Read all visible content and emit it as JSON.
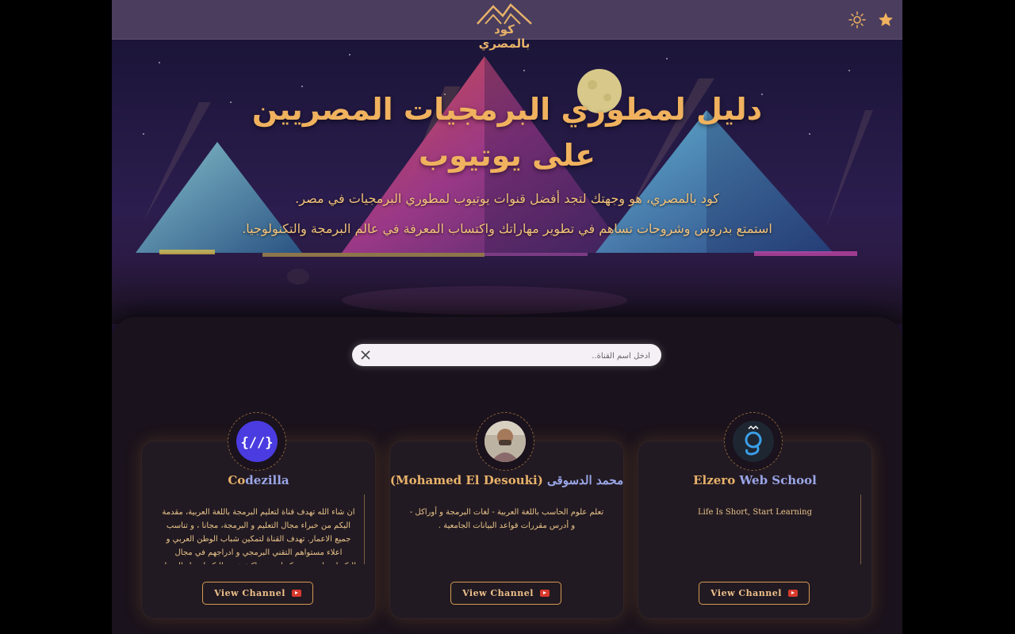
{
  "header": {
    "logo_text": "كود بالمصري",
    "icons": [
      "star-icon",
      "sun-icon"
    ],
    "accent": "#f0b25e"
  },
  "hero": {
    "title_line1": "دليل لمطوري البرمجيات المصريين",
    "title_line2": "على يوتيوب",
    "subtitle_line1": "كود بالمصري، هو وجهتك لتجد أفضل قنوات يوتيوب لمطوري البرمجيات في مصر.",
    "subtitle_line2": "استمتع بدروس وشروحات تساهم في تطوير مهاراتك واكتساب المعرفة في عالم البرمجة والتكنولوجيا."
  },
  "search": {
    "placeholder": "أدخل اسم القناة..",
    "value": ""
  },
  "channels": [
    {
      "name_a": "Elzero ",
      "name_b": "Web School",
      "description": "Life Is Short, Start Learning",
      "button_label": "View Channel",
      "avatar_icon": "elzero-logo-icon"
    },
    {
      "name_a": "محمد الدسوقى ",
      "name_b": "(Mohamed El Desouki)",
      "description": "تعلم علوم الحاسب باللغة العربية - لغات البرمجة و أوراكل - و أدرس مقررات قواعد البيانات الجامعية .",
      "button_label": "View Channel",
      "avatar_icon": "person-avatar-icon"
    },
    {
      "name_a": "Co",
      "name_b": "dezilla",
      "description": "ان شاء الله تهدف قناة لتعليم البرمجة باللغة العربية، مقدمة اليكم من خبراء مجال التعليم و البرمجة، مجانا ، و تناسب جميع الاعمار. تهدف القناة لتمكين شباب الوطن العربي و اعلاء مستواهم التقني البرمجي و ادراجهم في مجال التكنولوجيا حتى يتمكنوا من مواكبة عصر التكنولوجيا والتحول الرقمي",
      "button_label": "View Channel",
      "avatar_icon": "code-brackets-icon"
    }
  ]
}
